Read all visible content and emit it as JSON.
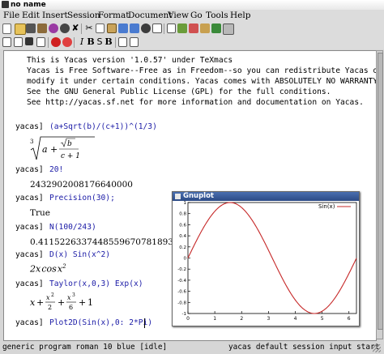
{
  "window": {
    "title": "no name"
  },
  "menu": [
    "File",
    "Edit",
    "Insert",
    "Session",
    "Format",
    "Document",
    "View",
    "Go",
    "Tools",
    "Help"
  ],
  "toolbar2": {
    "bold": "I",
    "italic_b": "B",
    "sans": "S",
    "sym": "B"
  },
  "banner": [
    "This is Yacas version '1.0.57' under TeXmacs",
    "Yacas is Free Software--Free as in Freedom--so you can redistribute Yacas or",
    "modify it under certain conditions. Yacas comes with ABSOLUTELY NO WARRANTY.",
    "See the GNU General Public License (GPL) for the full conditions.",
    "See http://yacas.sf.net for more information and documentation on Yacas."
  ],
  "session": {
    "prompt": "yacas]",
    "inputs": [
      "(a+Sqrt(b)/(c+1))^(1/3)",
      "20!",
      "Precision(30);",
      "N(100/243)",
      "D(x) Sin(x^2)",
      "Taylor(x,0,3) Exp(x)",
      "Plot2D(Sin(x),0: 2*Pi)"
    ],
    "outputs": {
      "factorial": "2432902008176640000",
      "precision": "True",
      "numeric": "0.411522633744855967078189300411"
    }
  },
  "status": {
    "left": "generic program roman 10 blue [idle]",
    "right": "yacas default session input start"
  },
  "gnuplot": {
    "title": "Gnuplot",
    "chart_data": {
      "type": "line",
      "title": "",
      "series": [
        {
          "name": "Sin(x)",
          "function": "sin(x)",
          "color": "#c62828"
        }
      ],
      "xlim": [
        0,
        6.28
      ],
      "ylim": [
        -1,
        1
      ],
      "x_ticks": [
        "0",
        "1",
        "2",
        "3",
        "4",
        "5",
        "6"
      ],
      "y_ticks": [
        "-1",
        "-0.8",
        "-0.6",
        "-0.4",
        "-0.2",
        "0",
        "0.2",
        "0.4",
        "0.6",
        "0.8",
        "1"
      ],
      "legend": "top-right"
    }
  }
}
